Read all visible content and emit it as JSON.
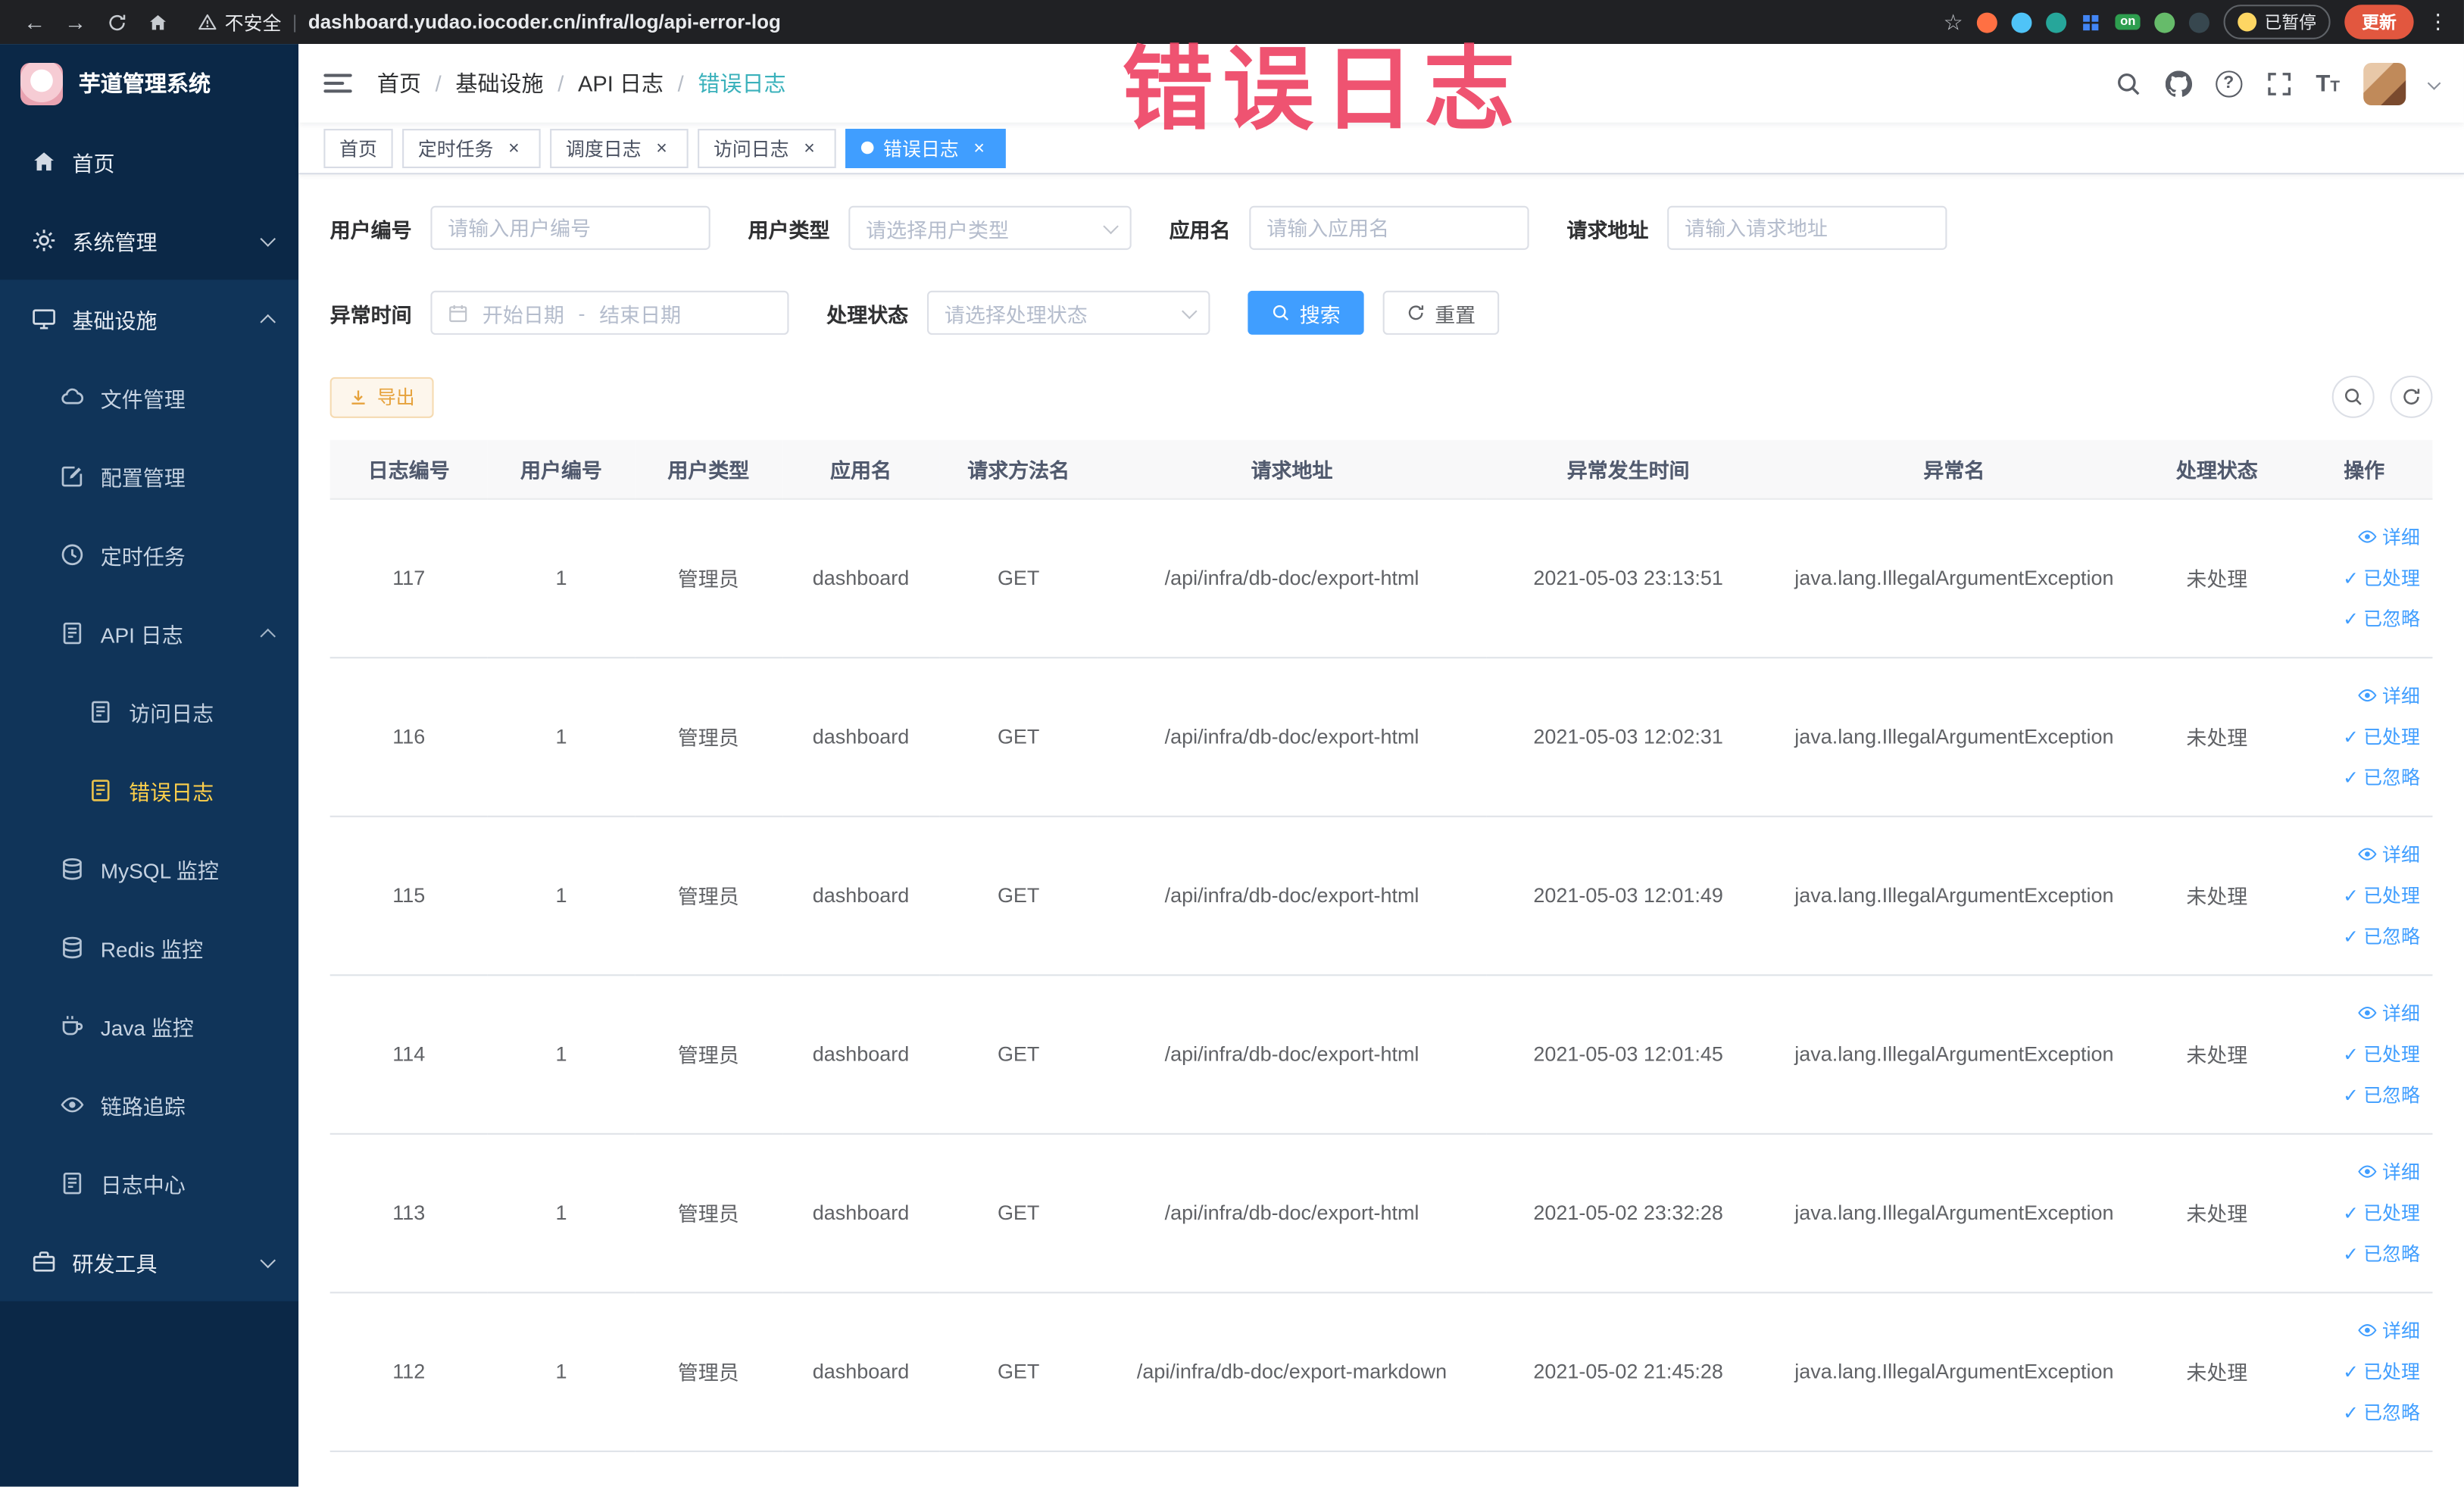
{
  "browser": {
    "security_label": "不安全",
    "url": "dashboard.yudao.iocoder.cn/infra/log/api-error-log",
    "extension_on_badge": "on",
    "paused_badge": "已暂停",
    "update_button": "更新"
  },
  "annotation": {
    "text": "错误日志",
    "color": "#ee4565"
  },
  "sidebar": {
    "logo_title": "芋道管理系统",
    "items": [
      {
        "label": "首页",
        "icon": "home-icon"
      },
      {
        "label": "系统管理",
        "icon": "gear-icon",
        "expanded": false
      },
      {
        "label": "基础设施",
        "icon": "monitor-icon",
        "expanded": true
      },
      {
        "label": "文件管理",
        "icon": "cloud-icon"
      },
      {
        "label": "配置管理",
        "icon": "edit-icon"
      },
      {
        "label": "定时任务",
        "icon": "clock-icon"
      },
      {
        "label": "API 日志",
        "icon": "document-icon",
        "expanded": true
      },
      {
        "label": "访问日志",
        "icon": "document-icon"
      },
      {
        "label": "错误日志",
        "icon": "document-icon",
        "active": true
      },
      {
        "label": "MySQL 监控",
        "icon": "database-icon"
      },
      {
        "label": "Redis 监控",
        "icon": "database-icon"
      },
      {
        "label": "Java 监控",
        "icon": "coffee-icon"
      },
      {
        "label": "链路追踪",
        "icon": "eye-icon"
      },
      {
        "label": "日志中心",
        "icon": "document-icon"
      },
      {
        "label": "研发工具",
        "icon": "toolbox-icon",
        "expanded": false
      }
    ]
  },
  "breadcrumb": [
    "首页",
    "基础设施",
    "API 日志",
    "错误日志"
  ],
  "tabs": [
    {
      "label": "首页",
      "closable": false,
      "active": false
    },
    {
      "label": "定时任务",
      "closable": true,
      "active": false
    },
    {
      "label": "调度日志",
      "closable": true,
      "active": false
    },
    {
      "label": "访问日志",
      "closable": true,
      "active": false
    },
    {
      "label": "错误日志",
      "closable": true,
      "active": true
    }
  ],
  "filters": {
    "user_id": {
      "label": "用户编号",
      "placeholder": "请输入用户编号",
      "value": ""
    },
    "user_type": {
      "label": "用户类型",
      "placeholder": "请选择用户类型",
      "value": ""
    },
    "app_name": {
      "label": "应用名",
      "placeholder": "请输入应用名",
      "value": ""
    },
    "request_url": {
      "label": "请求地址",
      "placeholder": "请输入请求地址",
      "value": ""
    },
    "exception_time": {
      "label": "异常时间",
      "start_placeholder": "开始日期",
      "separator": "-",
      "end_placeholder": "结束日期"
    },
    "process_status": {
      "label": "处理状态",
      "placeholder": "请选择处理状态",
      "value": ""
    },
    "search_button": "搜索",
    "reset_button": "重置"
  },
  "toolbar": {
    "export_button": "导出"
  },
  "table": {
    "columns": [
      "日志编号",
      "用户编号",
      "用户类型",
      "应用名",
      "请求方法名",
      "请求地址",
      "异常发生时间",
      "异常名",
      "处理状态",
      "操作"
    ],
    "row_actions": {
      "detail": "详细",
      "processed": "已处理",
      "ignored": "已忽略"
    },
    "rows": [
      {
        "log_id": "117",
        "user_id": "1",
        "user_type": "管理员",
        "app_name": "dashboard",
        "method": "GET",
        "url": "/api/infra/db-doc/export-html",
        "time": "2021-05-03 23:13:51",
        "exception": "java.lang.IllegalArgumentException",
        "status": "未处理"
      },
      {
        "log_id": "116",
        "user_id": "1",
        "user_type": "管理员",
        "app_name": "dashboard",
        "method": "GET",
        "url": "/api/infra/db-doc/export-html",
        "time": "2021-05-03 12:02:31",
        "exception": "java.lang.IllegalArgumentException",
        "status": "未处理"
      },
      {
        "log_id": "115",
        "user_id": "1",
        "user_type": "管理员",
        "app_name": "dashboard",
        "method": "GET",
        "url": "/api/infra/db-doc/export-html",
        "time": "2021-05-03 12:01:49",
        "exception": "java.lang.IllegalArgumentException",
        "status": "未处理"
      },
      {
        "log_id": "114",
        "user_id": "1",
        "user_type": "管理员",
        "app_name": "dashboard",
        "method": "GET",
        "url": "/api/infra/db-doc/export-html",
        "time": "2021-05-03 12:01:45",
        "exception": "java.lang.IllegalArgumentException",
        "status": "未处理"
      },
      {
        "log_id": "113",
        "user_id": "1",
        "user_type": "管理员",
        "app_name": "dashboard",
        "method": "GET",
        "url": "/api/infra/db-doc/export-html",
        "time": "2021-05-02 23:32:28",
        "exception": "java.lang.IllegalArgumentException",
        "status": "未处理"
      },
      {
        "log_id": "112",
        "user_id": "1",
        "user_type": "管理员",
        "app_name": "dashboard",
        "method": "GET",
        "url": "/api/infra/db-doc/export-markdown",
        "time": "2021-05-02 21:45:28",
        "exception": "java.lang.IllegalArgumentException",
        "status": "未处理"
      }
    ]
  }
}
